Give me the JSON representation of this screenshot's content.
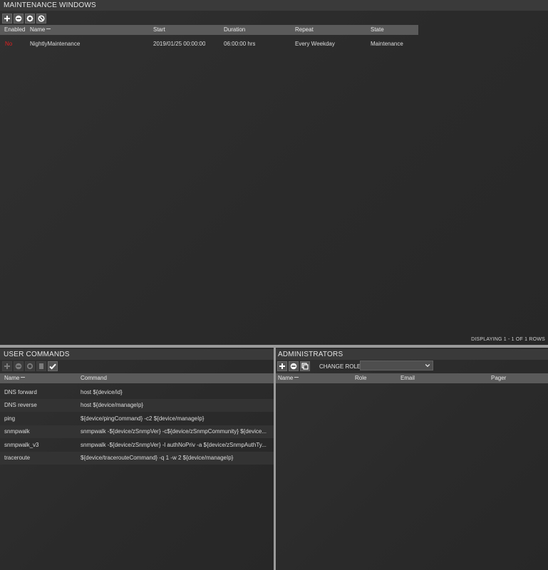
{
  "maintenance": {
    "title": "MAINTENANCE WINDOWS",
    "toolbar": [
      "add-icon",
      "remove-icon",
      "gear-icon",
      "block-icon"
    ],
    "columns": {
      "enabled": "Enabled",
      "name": "Name",
      "start": "Start",
      "duration": "Duration",
      "repeat": "Repeat",
      "state": "State"
    },
    "rows": [
      {
        "enabled": "No",
        "name": "NightlyMaintenance",
        "start": "2019/01/25 00:00:00",
        "duration": "06:00:00 hrs",
        "repeat": "Every Weekday",
        "state": "Maintenance"
      }
    ],
    "footer": "DISPLAYING 1 - 1 OF 1 ROWS"
  },
  "user_commands": {
    "title": "USER COMMANDS",
    "columns": {
      "name": "Name",
      "command": "Command"
    },
    "rows": [
      {
        "name": "DNS forward",
        "command": "host ${device/id}"
      },
      {
        "name": "DNS reverse",
        "command": "host ${device/manageIp}"
      },
      {
        "name": "ping",
        "command": "${device/pingCommand} -c2 ${device/manageIp}"
      },
      {
        "name": "snmpwalk",
        "command": "snmpwalk -${device/zSnmpVer} -c${device/zSnmpCommunity} ${device..."
      },
      {
        "name": "snmpwalk_v3",
        "command": "snmpwalk -${device/zSnmpVer} -l authNoPriv -a ${device/zSnmpAuthTy..."
      },
      {
        "name": "traceroute",
        "command": "${device/tracerouteCommand} -q 1 -w 2 ${device/manageIp}"
      }
    ]
  },
  "administrators": {
    "title": "ADMINISTRATORS",
    "change_role_label": "CHANGE ROLE:",
    "change_role_value": "",
    "columns": {
      "name": "Name",
      "role": "Role",
      "email": "Email",
      "pager": "Pager"
    }
  },
  "colors": {
    "disabled_red": "#e02020",
    "header_bg": "#5a5a5a",
    "divider": "#9a9a9a"
  }
}
